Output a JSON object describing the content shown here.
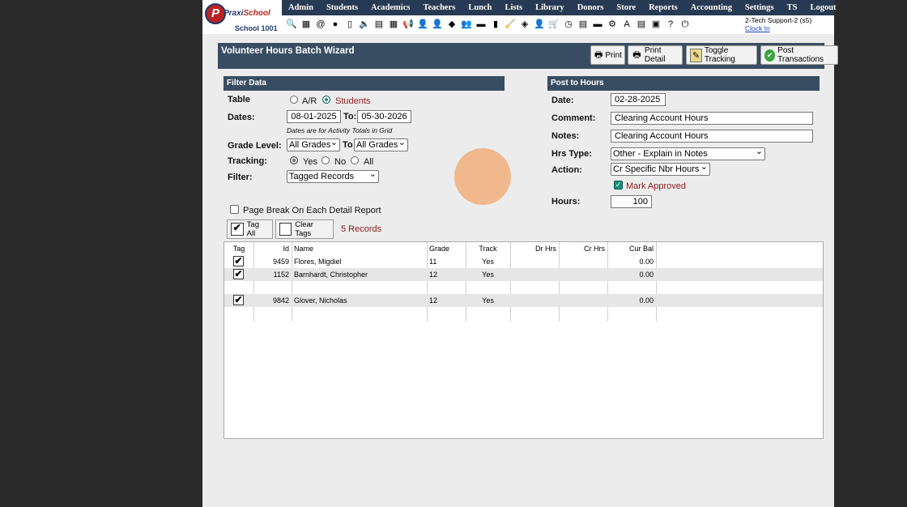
{
  "brand": {
    "logo_letter": "P",
    "name_part1": "Praxi",
    "name_part2": "School",
    "school": "School 1001"
  },
  "menu": [
    "Admin",
    "Students",
    "Academics",
    "Teachers",
    "Lunch",
    "Lists",
    "Library",
    "Donors",
    "Store",
    "Reports",
    "Accounting",
    "Settings",
    "TS",
    "Logout"
  ],
  "toolbar_icons": [
    {
      "name": "search-icon",
      "glyph": "🔍"
    },
    {
      "name": "calculator-icon",
      "glyph": "▦"
    },
    {
      "name": "at-icon",
      "glyph": "@"
    },
    {
      "name": "chat-icon",
      "glyph": "●"
    },
    {
      "name": "phone-icon",
      "glyph": "▯"
    },
    {
      "name": "speaker-icon",
      "glyph": "🔈"
    },
    {
      "name": "form-icon",
      "glyph": "▤"
    },
    {
      "name": "calendar-icon",
      "glyph": "▦"
    },
    {
      "name": "megaphone-icon",
      "glyph": "📢"
    },
    {
      "name": "person-icon",
      "glyph": "👤"
    },
    {
      "name": "teacher-icon",
      "glyph": "👤"
    },
    {
      "name": "tag-icon",
      "glyph": "◆"
    },
    {
      "name": "users-icon",
      "glyph": "👥"
    },
    {
      "name": "lunch-icon",
      "glyph": "▬"
    },
    {
      "name": "book-icon",
      "glyph": "▮"
    },
    {
      "name": "broom-icon",
      "glyph": "🧹"
    },
    {
      "name": "gift-icon",
      "glyph": "◈"
    },
    {
      "name": "staff-icon",
      "glyph": "👤"
    },
    {
      "name": "cart-icon",
      "glyph": "🛒"
    },
    {
      "name": "clock-icon",
      "glyph": "◷"
    },
    {
      "name": "report-icon",
      "glyph": "▤"
    },
    {
      "name": "money-icon",
      "glyph": "▬"
    },
    {
      "name": "settings-icon",
      "glyph": "⚙"
    },
    {
      "name": "ap-icon",
      "glyph": "A"
    },
    {
      "name": "pdf-icon",
      "glyph": "▤"
    },
    {
      "name": "print-icon",
      "glyph": "▣"
    },
    {
      "name": "help-icon",
      "glyph": "?"
    },
    {
      "name": "power-icon",
      "glyph": "⏻"
    }
  ],
  "user": {
    "line1": "2-Tech Support-2 (s5)",
    "clock_in": "Clock In"
  },
  "header": {
    "title": "Volunteer Hours Batch Wizard",
    "buttons": {
      "print": "Print",
      "print_detail": "Print Detail",
      "toggle_tracking": "Toggle Tracking",
      "post_transactions": "Post Transactions"
    }
  },
  "filter": {
    "section_title": "Filter Data",
    "table_label": "Table",
    "table_options": [
      "A/R",
      "Students"
    ],
    "table_selected": "Students",
    "dates_label": "Dates:",
    "date_from": "08-01-2025",
    "to_label": "To:",
    "date_to": "05-30-2026",
    "dates_note": "Dates are for Activity Totals in Grid",
    "grade_label": "Grade Level:",
    "grade_from": "All Grades",
    "grade_to_label": "To",
    "grade_to": "All Grades",
    "tracking_label": "Tracking:",
    "tracking_options": [
      "Yes",
      "No",
      "All"
    ],
    "tracking_selected": "Yes",
    "filter_label": "Filter:",
    "filter_value": "Tagged Records",
    "page_break_label": "Page Break On Each Detail Report",
    "page_break_checked": false,
    "tag_all": "Tag All",
    "clear_tags": "Clear Tags",
    "record_count": "5 Records"
  },
  "post": {
    "section_title": "Post to Hours",
    "date_label": "Date:",
    "date": "02-28-2025",
    "comment_label": "Comment:",
    "comment": "Clearing Account Hours",
    "notes_label": "Notes:",
    "notes": "Clearing Account Hours",
    "hrs_type_label": "Hrs Type:",
    "hrs_type": "Other - Explain in Notes",
    "action_label": "Action:",
    "action": "Cr Specific Nbr Hours",
    "mark_approved_label": "Mark Approved",
    "mark_approved_checked": true,
    "hours_label": "Hours:",
    "hours": "100"
  },
  "grid": {
    "columns": [
      "Tag",
      "Id",
      "Name",
      "Grade",
      "Track",
      "Dr Hrs",
      "Cr Hrs",
      "Cur Bal"
    ],
    "rows": [
      {
        "tagged": true,
        "id": "9459",
        "name": "Flores, Migdiel",
        "grade": "11",
        "track": "Yes",
        "dr": "",
        "cr": "",
        "bal": "0.00"
      },
      {
        "tagged": true,
        "id": "1152",
        "name": "Barnhardt, Christopher",
        "grade": "12",
        "track": "Yes",
        "dr": "",
        "cr": "",
        "bal": "0.00"
      },
      {
        "tagged": false,
        "id": "",
        "name": "",
        "grade": "",
        "track": "",
        "dr": "",
        "cr": "",
        "bal": ""
      },
      {
        "tagged": true,
        "id": "9842",
        "name": "Glover, Nicholas",
        "grade": "12",
        "track": "Yes",
        "dr": "",
        "cr": "",
        "bal": "0.00"
      },
      {
        "tagged": false,
        "id": "",
        "name": "",
        "grade": "",
        "track": "",
        "dr": "",
        "cr": "",
        "bal": ""
      }
    ]
  }
}
